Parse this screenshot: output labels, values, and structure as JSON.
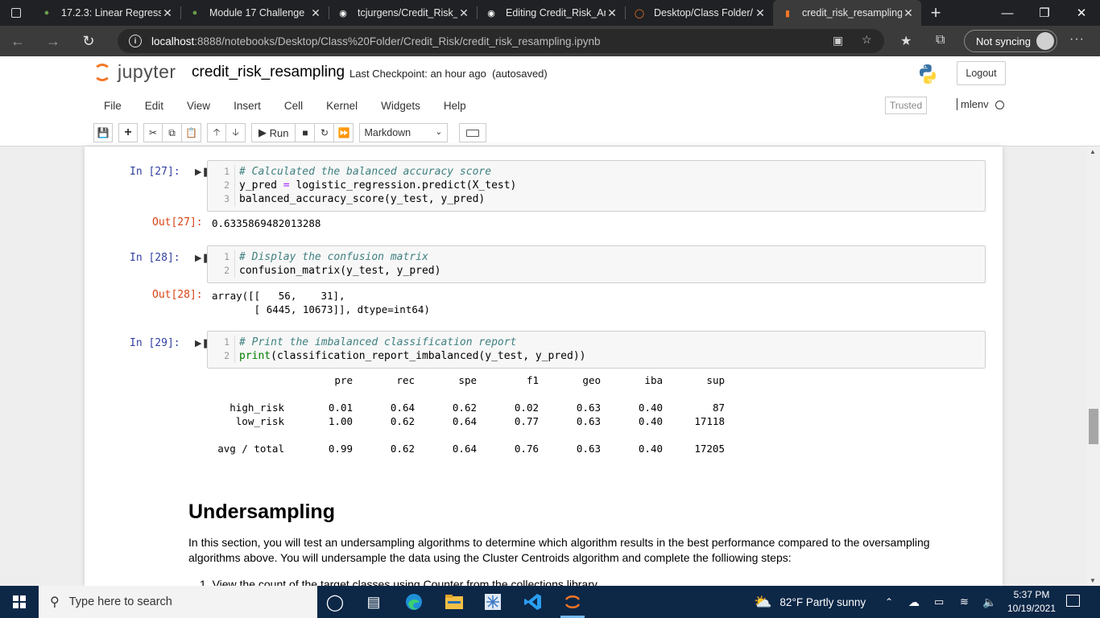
{
  "browser": {
    "tabs": [
      {
        "label": "17.2.3: Linear Regressio",
        "icon": "canvas-icon"
      },
      {
        "label": "Module 17 Challenge",
        "icon": "canvas-icon"
      },
      {
        "label": "tcjurgens/Credit_Risk_",
        "icon": "github-icon"
      },
      {
        "label": "Editing Credit_Risk_An",
        "icon": "github-icon"
      },
      {
        "label": "Desktop/Class Folder/",
        "icon": "jupyter-icon"
      },
      {
        "label": "credit_risk_resampling",
        "icon": "notebook-icon",
        "active": true
      }
    ],
    "url_host": "localhost",
    "url_rest": ":8888/notebooks/Desktop/Class%20Folder/Credit_Risk/credit_risk_resampling.ipynb",
    "sync_label": "Not syncing"
  },
  "jupyter": {
    "logo_text": "jupyter",
    "notebook_name": "credit_risk_resampling",
    "checkpoint": "Last Checkpoint: an hour ago",
    "autosave": "(autosaved)",
    "logout": "Logout",
    "menu": [
      "File",
      "Edit",
      "View",
      "Insert",
      "Cell",
      "Kernel",
      "Widgets",
      "Help"
    ],
    "trusted": "Trusted",
    "kernel": "mlenv",
    "run_label": "Run",
    "cell_type": "Markdown"
  },
  "cells": [
    {
      "prompt_in": "In [27]:",
      "lines": [
        {
          "n": "1",
          "text": "# Calculated the balanced accuracy score",
          "comment": true
        },
        {
          "n": "2",
          "text": "y_pred = logistic_regression.predict(X_test)"
        },
        {
          "n": "3",
          "text": "balanced_accuracy_score(y_test, y_pred)"
        }
      ],
      "prompt_out": "Out[27]:",
      "output": "0.6335869482013288"
    },
    {
      "prompt_in": "In [28]:",
      "lines": [
        {
          "n": "1",
          "text": "# Display the confusion matrix",
          "comment": true
        },
        {
          "n": "2",
          "text": "confusion_matrix(y_test, y_pred)"
        }
      ],
      "prompt_out": "Out[28]:",
      "output": "array([[   56,    31],\n       [ 6445, 10673]], dtype=int64)"
    },
    {
      "prompt_in": "In [29]:",
      "lines": [
        {
          "n": "1",
          "text": "# Print the imbalanced classification report",
          "comment": true
        },
        {
          "n": "2",
          "text": "print(classification_report_imbalanced(y_test, y_pred))"
        }
      ]
    }
  ],
  "report": {
    "headers": [
      "pre",
      "rec",
      "spe",
      "f1",
      "geo",
      "iba",
      "sup"
    ],
    "rows": [
      {
        "label": "high_risk",
        "values": [
          "0.01",
          "0.64",
          "0.62",
          "0.02",
          "0.63",
          "0.40",
          "87"
        ]
      },
      {
        "label": "low_risk",
        "values": [
          "1.00",
          "0.62",
          "0.64",
          "0.77",
          "0.63",
          "0.40",
          "17118"
        ]
      },
      {
        "label": "avg / total",
        "values": [
          "0.99",
          "0.62",
          "0.64",
          "0.76",
          "0.63",
          "0.40",
          "17205"
        ]
      }
    ]
  },
  "markdown": {
    "heading": "Undersampling",
    "paragraph": "In this section, you will test an undersampling algorithms to determine which algorithm results in the best performance compared to the oversampling algorithms above. You will undersample the data using the Cluster Centroids algorithm and complete the folliowing steps:",
    "list_item_partial": "1. View the count of the target classes using Counter from the collections library"
  },
  "taskbar": {
    "search_placeholder": "Type here to search",
    "weather": "82°F  Partly sunny",
    "time": "5:37 PM",
    "date": "10/19/2021"
  }
}
